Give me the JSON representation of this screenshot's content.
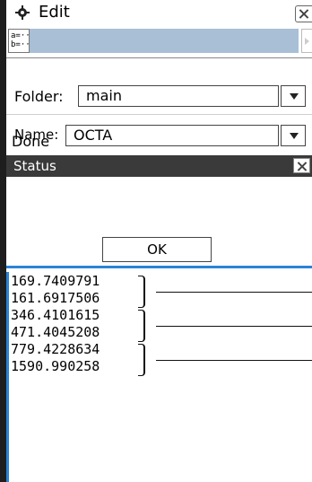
{
  "window": {
    "title": "Edit"
  },
  "toolbar": {
    "vars_button_line1": "a=···",
    "vars_button_line2": "b=···"
  },
  "form": {
    "folder_label": "Folder:",
    "folder_value": "main",
    "name_label": "Name:",
    "name_value": "OCTA"
  },
  "status": {
    "title": "Status",
    "message": "Done",
    "ok_label": "OK"
  },
  "results": [
    {
      "top": "169.7409791",
      "bottom": "161.6917506"
    },
    {
      "top": "346.4101615",
      "bottom": "471.4045208"
    },
    {
      "top": "779.4228634",
      "bottom": "1590.990258"
    }
  ]
}
